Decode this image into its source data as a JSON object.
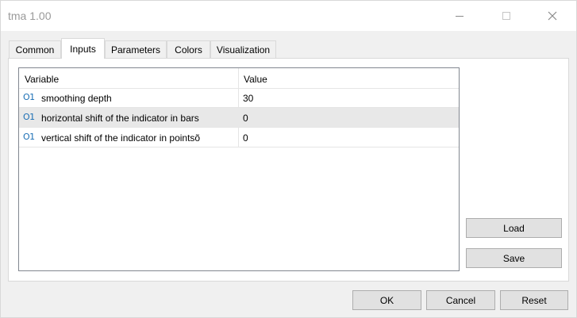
{
  "window": {
    "title": "tma 1.00"
  },
  "tabs": [
    {
      "label": "Common"
    },
    {
      "label": "Inputs",
      "active": true
    },
    {
      "label": "Parameters"
    },
    {
      "label": "Colors"
    },
    {
      "label": "Visualization"
    }
  ],
  "grid": {
    "headers": {
      "variable": "Variable",
      "value": "Value"
    },
    "rows": [
      {
        "icon": "O1",
        "name": "smoothing depth",
        "value": "30"
      },
      {
        "icon": "O1",
        "name": "horizontal shift of the indicator in bars",
        "value": "0",
        "selected": true
      },
      {
        "icon": "O1",
        "name": "vertical shift of the indicator in pointsõ",
        "value": "0"
      }
    ]
  },
  "side_buttons": {
    "load": "Load",
    "save": "Save"
  },
  "footer_buttons": {
    "ok": "OK",
    "cancel": "Cancel",
    "reset": "Reset"
  },
  "icons": {
    "minimize": "minimize-icon",
    "maximize": "maximize-icon",
    "close": "close-icon",
    "row_type": "integer-type-icon"
  }
}
